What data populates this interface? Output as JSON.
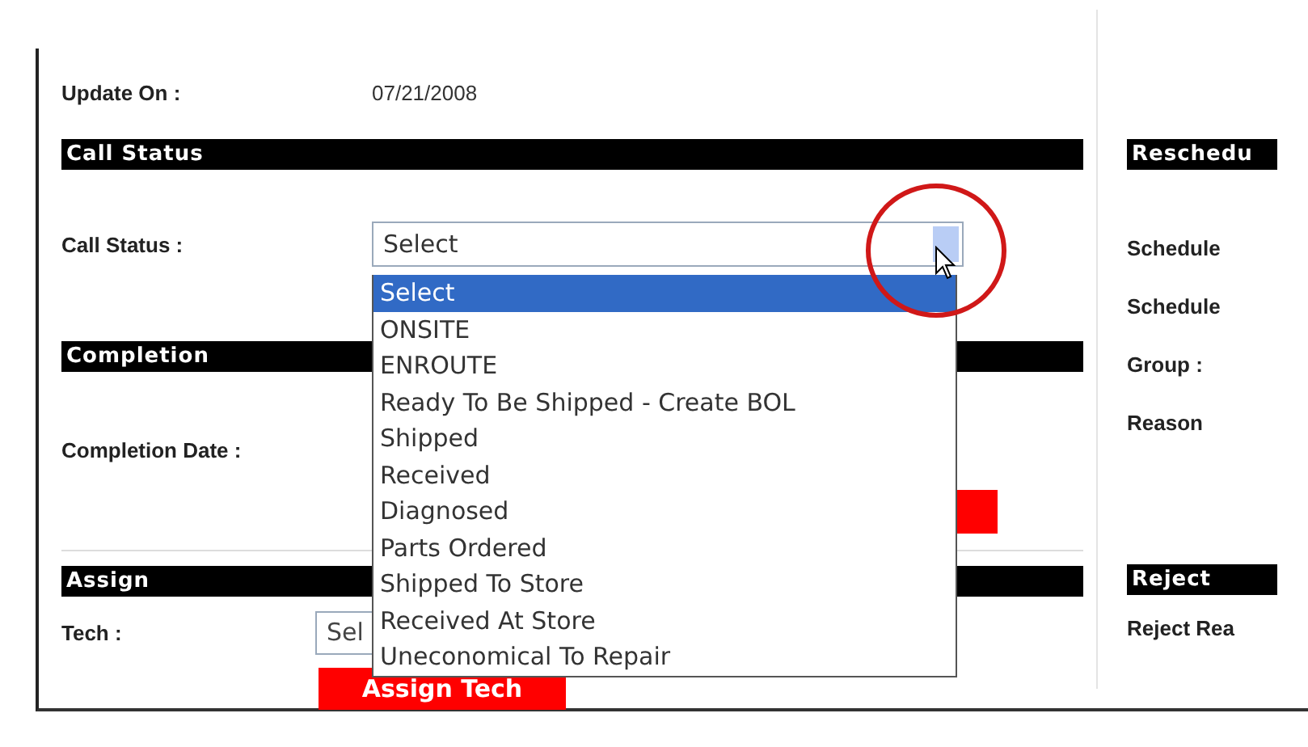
{
  "record": {
    "label": "Update On :",
    "value": "07/21/2008"
  },
  "call_status": {
    "header": "Call Status",
    "label": "Call Status :",
    "select": {
      "value": "Select",
      "expanded": true,
      "options": [
        {
          "label": "Select",
          "selected": true
        },
        {
          "label": "ONSITE",
          "selected": false
        },
        {
          "label": "ENROUTE",
          "selected": false
        },
        {
          "label": "Ready To Be Shipped - Create BOL",
          "selected": false
        },
        {
          "label": "Shipped",
          "selected": false
        },
        {
          "label": "Received",
          "selected": false
        },
        {
          "label": "Diagnosed",
          "selected": false
        },
        {
          "label": "Parts Ordered",
          "selected": false
        },
        {
          "label": "Shipped To Store",
          "selected": false
        },
        {
          "label": "Received At Store",
          "selected": false
        },
        {
          "label": "Uneconomical To Repair",
          "selected": false
        }
      ]
    }
  },
  "completion": {
    "header": "Completion",
    "label": "Completion Date :"
  },
  "assign": {
    "header": "Assign",
    "label": "Tech :",
    "select": {
      "value": "Sel"
    },
    "button": "Assign Tech"
  },
  "reschedule": {
    "header": "Reschedu",
    "labels": [
      "Schedule",
      "Schedule",
      "Group :",
      "Reason"
    ]
  },
  "reject": {
    "header": "Reject",
    "label": "Reject Rea"
  }
}
